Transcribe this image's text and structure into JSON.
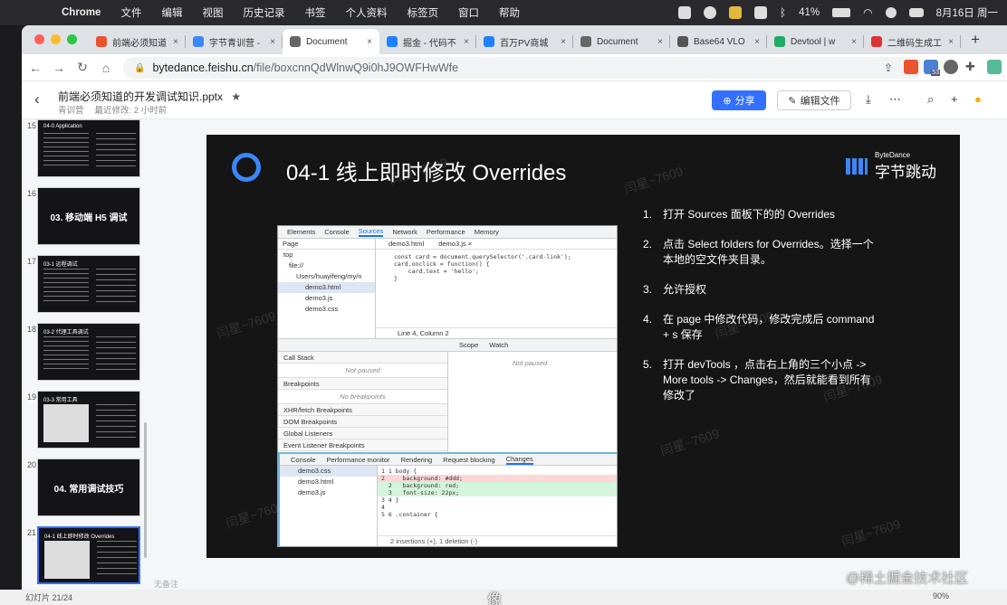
{
  "menubar": {
    "app": "Chrome",
    "items": [
      "文件",
      "编辑",
      "视图",
      "历史记录",
      "书签",
      "个人资料",
      "标签页",
      "窗口",
      "帮助"
    ],
    "battery": "41%",
    "date": "8月16日 周一"
  },
  "browser": {
    "tabs": [
      {
        "title": "前端必须知道",
        "color": "#e8542f"
      },
      {
        "title": "字节青训营 -",
        "color": "#3b87f7"
      },
      {
        "title": "Document",
        "color": "#666"
      },
      {
        "title": "掘金 - 代码不",
        "color": "#1e80ff"
      },
      {
        "title": "百万PV商城",
        "color": "#1e80ff"
      },
      {
        "title": "Document",
        "color": "#666"
      },
      {
        "title": "Base64 VLO",
        "color": "#555"
      },
      {
        "title": "Devtool | w",
        "color": "#2a6"
      },
      {
        "title": "二维码生成工",
        "color": "#d33"
      }
    ],
    "url_host": "bytedance.feishu.cn",
    "url_path": "/file/boxcnnQdWlnwQ9i0hJ9OWFHwWfe",
    "ext_badge": "53"
  },
  "doc": {
    "title": "前端必须知道的开发调试知识.pptx",
    "owner": "青训营",
    "modified": "最近修改: 2 小时前",
    "share_label": "分享",
    "edit_label": "编辑文件",
    "notes_placeholder": "无备注"
  },
  "thumbnails": [
    {
      "num": "15",
      "label": "04-0 Application",
      "big": "",
      "type": "list"
    },
    {
      "num": "16",
      "label": "",
      "big": "03. 移动端 H5 调试",
      "type": "section"
    },
    {
      "num": "17",
      "label": "03-1 远程调试",
      "big": "",
      "type": "list"
    },
    {
      "num": "18",
      "label": "03-2 代理工具调试",
      "big": "",
      "type": "list"
    },
    {
      "num": "19",
      "label": "03-3 常用工具",
      "big": "",
      "type": "shot"
    },
    {
      "num": "20",
      "label": "",
      "big": "04. 常用调试技巧",
      "type": "section"
    },
    {
      "num": "21",
      "label": "04-1 线上即时修改 Overrides",
      "big": "",
      "type": "shot"
    }
  ],
  "slide": {
    "title": "04-1 线上即时修改 Overrides",
    "brand_en": "ByteDance",
    "brand_zh": "字节跳动",
    "watermark": "闫星~7609",
    "steps": [
      {
        "n": "1.",
        "text": "打开 Sources 面板下的的 Overrides"
      },
      {
        "n": "2.",
        "text": "点击 Select folders for Overrides。选择一个本地的空文件夹目录。"
      },
      {
        "n": "3.",
        "text": "允许授权"
      },
      {
        "n": "4.",
        "text": "在 page 中修改代码，修改完成后 command + s 保存"
      },
      {
        "n": "5.",
        "text": "打开 devTools ，点击右上角的三个小点 -> More tools -> Changes，然后就能看到所有修改了"
      }
    ]
  },
  "devtools": {
    "tabs": [
      "Elements",
      "Console",
      "Sources",
      "Network",
      "Performance",
      "Memory"
    ],
    "active_tab": "Sources",
    "page_label": "Page",
    "tree": [
      "top",
      "file://",
      "Users/huayifeng/my/n",
      "demo3.html",
      "demo3.js",
      "demo3.css"
    ],
    "open_files": [
      "demo3.html",
      "demo3.js ×"
    ],
    "code": "const card = document.querySelector('.card-link');\ncard.onclick = function() {\n    card.text = 'hello';\n}",
    "position": "Line 4, Column 2",
    "scope_tabs": [
      "Scope",
      "Watch"
    ],
    "not_paused": "Not paused",
    "sections": [
      "Call Stack",
      "Breakpoints",
      "XHR/fetch Breakpoints",
      "DOM Breakpoints",
      "Global Listeners",
      "Event Listener Breakpoints"
    ],
    "no_breakpoints": "No breakpoints",
    "drawer_tabs": [
      "Console",
      "Performance monitor",
      "Rendering",
      "Request blocking",
      "Changes"
    ],
    "changed_files": [
      "demo3.css",
      "demo3.html",
      "demo3.js"
    ],
    "diff": [
      {
        "t": "1 1 body {",
        "k": ""
      },
      {
        "t": "2     background: #ddd;",
        "k": "del"
      },
      {
        "t": "  2   background: red;",
        "k": "add"
      },
      {
        "t": "  3   font-size: 22px;",
        "k": "add"
      },
      {
        "t": "3 4 }",
        "k": ""
      },
      {
        "t": "4",
        "k": ""
      },
      {
        "t": "5 6 .container {",
        "k": ""
      }
    ],
    "diff_footer": "2 insertions (+), 1 deletion (-)"
  },
  "footer": {
    "slide_counter": "幻灯片 21/24",
    "zoom": "90%",
    "subtitle": "像",
    "watermark_site": "@稀土掘金技术社区"
  },
  "colors": {
    "accent": "#3370ff",
    "slide_bg": "#151515",
    "logo_blue": "#3b87f7"
  }
}
